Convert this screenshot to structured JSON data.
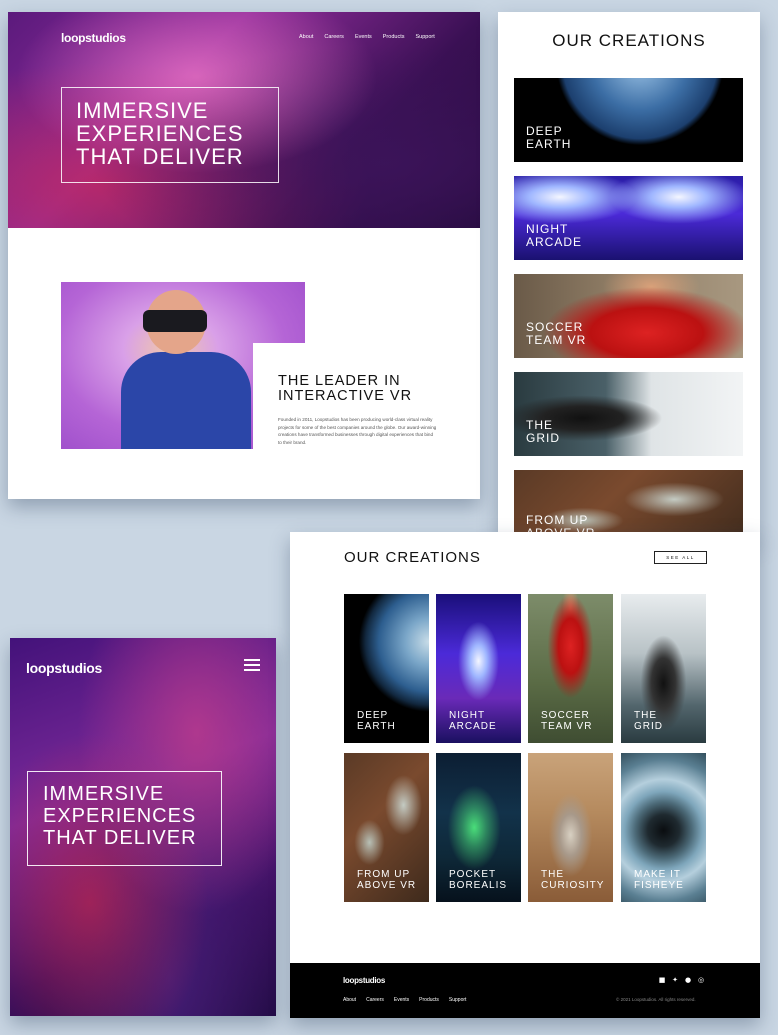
{
  "brand": "loopstudios",
  "nav": [
    "About",
    "Careers",
    "Events",
    "Products",
    "Support"
  ],
  "hero": {
    "line1": "IMMERSIVE",
    "line2": "EXPERIENCES",
    "line3": "THAT DELIVER"
  },
  "leader": {
    "line1": "THE LEADER IN",
    "line2": "INTERACTIVE VR",
    "body": "Founded in 2011, Loopstudios has been producing world-class virtual reality projects for some of the best companies around the globe. Our award-winning creations have transformed businesses through digital experiences that bind to their brand."
  },
  "creations": {
    "title": "OUR CREATIONS",
    "see_all": "SEE ALL",
    "items": [
      {
        "l1": "DEEP",
        "l2": "EARTH"
      },
      {
        "l1": "NIGHT",
        "l2": "ARCADE"
      },
      {
        "l1": "SOCCER",
        "l2": "TEAM VR"
      },
      {
        "l1": "THE",
        "l2": "GRID"
      },
      {
        "l1": "FROM UP",
        "l2": "ABOVE VR"
      },
      {
        "l1": "POCKET",
        "l2": "BOREALIS"
      },
      {
        "l1": "THE",
        "l2": "CURIOSITY"
      },
      {
        "l1": "MAKE IT",
        "l2": "FISHEYE"
      }
    ]
  },
  "footer": {
    "copyright": "© 2021 Loopstudios. All rights reserved.",
    "social_icons": [
      "facebook-icon",
      "twitter-icon",
      "pinterest-icon",
      "instagram-icon"
    ]
  }
}
